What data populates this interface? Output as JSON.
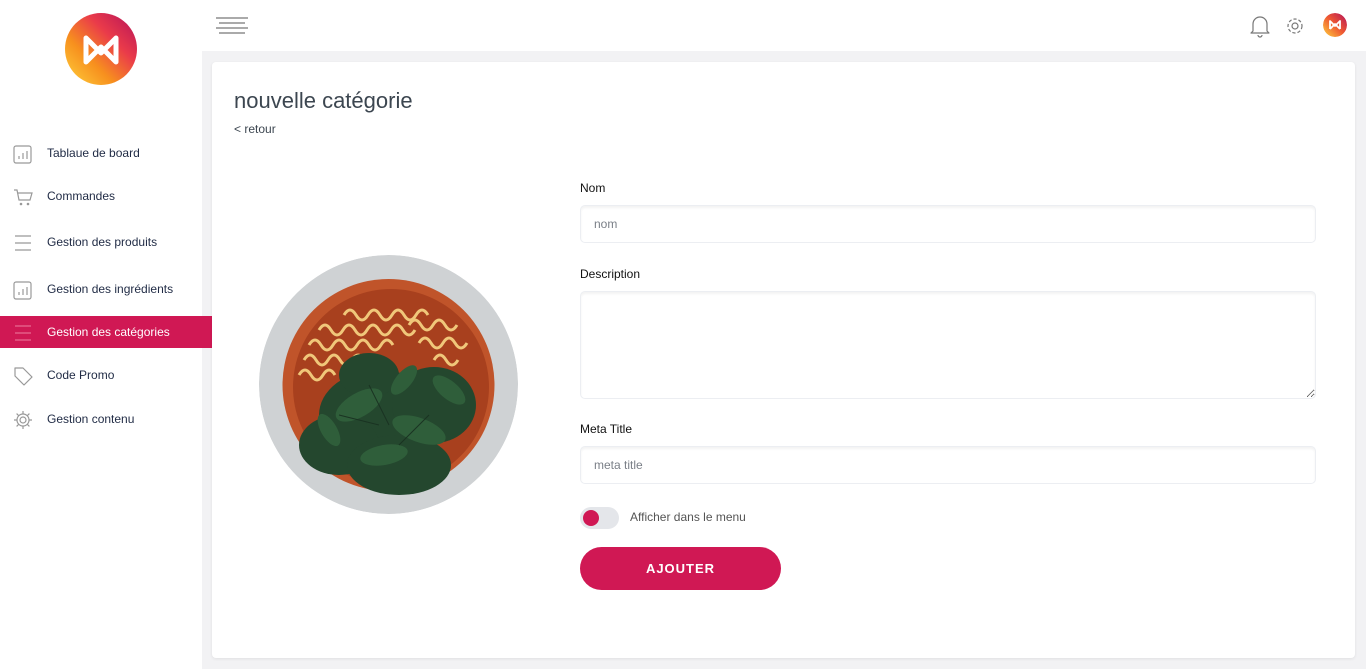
{
  "brand": {
    "accent": "#d01854"
  },
  "sidebar": {
    "items": [
      {
        "label": "Tablaue de board",
        "icon": "chart-icon"
      },
      {
        "label": "Commandes",
        "icon": "cart-icon"
      },
      {
        "label": "Gestion des produits",
        "icon": "list-icon"
      },
      {
        "label": "Gestion des ingrédients",
        "icon": "chart-icon"
      },
      {
        "label": "Gestion des catégories",
        "icon": "list-icon",
        "active": true
      },
      {
        "label": "Code Promo",
        "icon": "tag-icon"
      },
      {
        "label": "Gestion contenu",
        "icon": "gear-icon"
      }
    ]
  },
  "topbar": {
    "icons": [
      "menu-icon",
      "bell-icon",
      "gear-icon",
      "avatar"
    ]
  },
  "page": {
    "title": "nouvelle catégorie",
    "back": "< retour"
  },
  "form": {
    "name_label": "Nom",
    "name_placeholder": "nom",
    "name_value": "",
    "description_label": "Description",
    "description_value": "",
    "meta_label": "Meta Title",
    "meta_placeholder": "meta title",
    "meta_value": "",
    "toggle_label": "Afficher dans le menu",
    "toggle_on": false,
    "submit_label": "AJOUTER"
  }
}
